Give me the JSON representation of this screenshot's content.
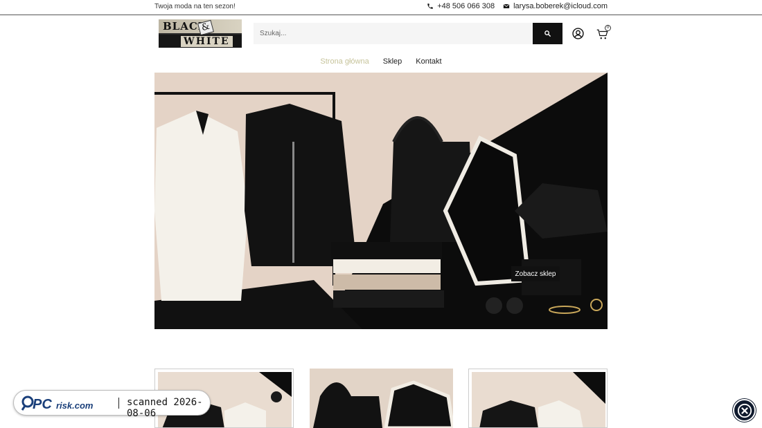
{
  "topbar": {
    "tagline": "Twoja moda na ten sezon!",
    "phone": "+48 506 066 308",
    "email": "larysa.boberek@icloud.com"
  },
  "logo": {
    "line1": "BLACK",
    "amp": "&",
    "line2": "WHITE"
  },
  "search": {
    "placeholder": "Szukaj..."
  },
  "cart": {
    "count": "0"
  },
  "nav": {
    "items": [
      "Strona główna",
      "Sklep",
      "Kontakt"
    ],
    "active_color": "#c6c39a"
  },
  "hero": {
    "button_label": "Zobacz sklep"
  },
  "badge": {
    "brand": "PCrisk.com",
    "scanned": "scanned 2026-08-06"
  },
  "colors": {
    "accent": "#c6c39a",
    "dark": "#111111",
    "hero_bg": "#e6d6c9"
  }
}
